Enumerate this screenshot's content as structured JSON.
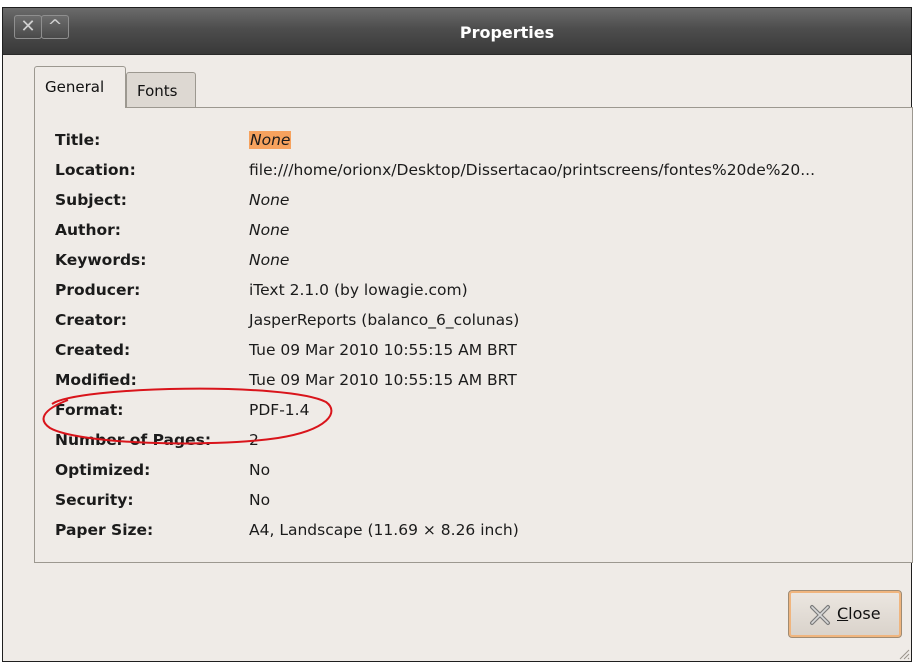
{
  "window": {
    "title": "Properties",
    "close_glyph": "✕",
    "maximize_glyph": "^"
  },
  "tabs": [
    {
      "label": "General",
      "active": true
    },
    {
      "label": "Fonts",
      "active": false
    }
  ],
  "properties": [
    {
      "label": "Title:",
      "value": "None",
      "italic": true,
      "highlighted": true
    },
    {
      "label": "Location:",
      "value": "file:///home/orionx/Desktop/Dissertacao/printscreens/fontes%20de%20...",
      "italic": false
    },
    {
      "label": "Subject:",
      "value": "None",
      "italic": true
    },
    {
      "label": "Author:",
      "value": "None",
      "italic": true
    },
    {
      "label": "Keywords:",
      "value": "None",
      "italic": true
    },
    {
      "label": "Producer:",
      "value": "iText 2.1.0 (by lowagie.com)",
      "italic": false
    },
    {
      "label": "Creator:",
      "value": "JasperReports (balanco_6_colunas)",
      "italic": false
    },
    {
      "label": "Created:",
      "value": "Tue 09 Mar 2010 10:55:15 AM BRT",
      "italic": false
    },
    {
      "label": "Modified:",
      "value": "Tue 09 Mar 2010 10:55:15 AM BRT",
      "italic": false
    },
    {
      "label": "Format:",
      "value": "PDF-1.4",
      "italic": false
    },
    {
      "label": "Number of Pages:",
      "value": "2",
      "italic": false
    },
    {
      "label": "Optimized:",
      "value": "No",
      "italic": false
    },
    {
      "label": "Security:",
      "value": "No",
      "italic": false
    },
    {
      "label": "Paper Size:",
      "value": "A4, Landscape (11.69 × 8.26 inch)",
      "italic": false
    }
  ],
  "buttons": {
    "close_label_mnemonic": "C",
    "close_label_rest": "lose"
  },
  "colors": {
    "highlight": "#f6a25e",
    "annotation": "#d9141b",
    "titlebar": "#4d4d4d"
  },
  "icons": [
    "close-icon",
    "maximize-icon",
    "close-x-icon",
    "resize-grip-icon"
  ]
}
